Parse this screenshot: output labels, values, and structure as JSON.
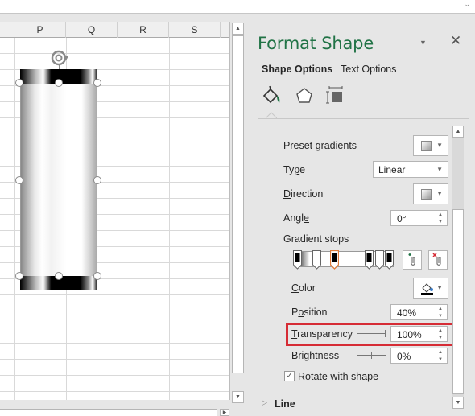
{
  "sheet": {
    "columns": [
      "P",
      "Q",
      "R",
      "S"
    ]
  },
  "pane": {
    "title": "Format Shape",
    "tabs": [
      {
        "label": "Shape Options",
        "active": true
      },
      {
        "label": "Text Options",
        "active": false
      }
    ],
    "category_icons": [
      "fill-line-icon",
      "effects-pentagon-icon",
      "size-properties-icon"
    ],
    "fields": {
      "preset_gradients": {
        "label_pre": "P",
        "label_u": "r",
        "label_post": "eset gradients"
      },
      "type": {
        "label_pre": "Ty",
        "label_u": "p",
        "label_post": "e",
        "value": "Linear"
      },
      "direction": {
        "label_pre": "",
        "label_u": "D",
        "label_post": "irection"
      },
      "angle": {
        "label_pre": "Angl",
        "label_u": "e",
        "label_post": "",
        "value": "0°"
      },
      "gradient_stops": {
        "label": "Gradient stops",
        "stops_count": 6,
        "selected_stop": 3
      },
      "color": {
        "label_pre": "",
        "label_u": "C",
        "label_post": "olor"
      },
      "position": {
        "label_pre": "P",
        "label_u": "o",
        "label_post": "sition",
        "value": "40%"
      },
      "transparency": {
        "label_pre": "",
        "label_u": "T",
        "label_post": "ransparency",
        "value": "100%",
        "slider_fraction": 1.0
      },
      "brightness": {
        "label_pre": "Bri",
        "label_u": "g",
        "label_post": "htness",
        "value": "0%",
        "slider_fraction": 0.5
      },
      "rotate_with_shape": {
        "label_pre": "Rotate ",
        "label_u": "w",
        "label_post": "ith shape",
        "checked": true
      }
    },
    "next_section": "Line",
    "highlight_color": "#d62c35",
    "title_color": "#217346"
  }
}
